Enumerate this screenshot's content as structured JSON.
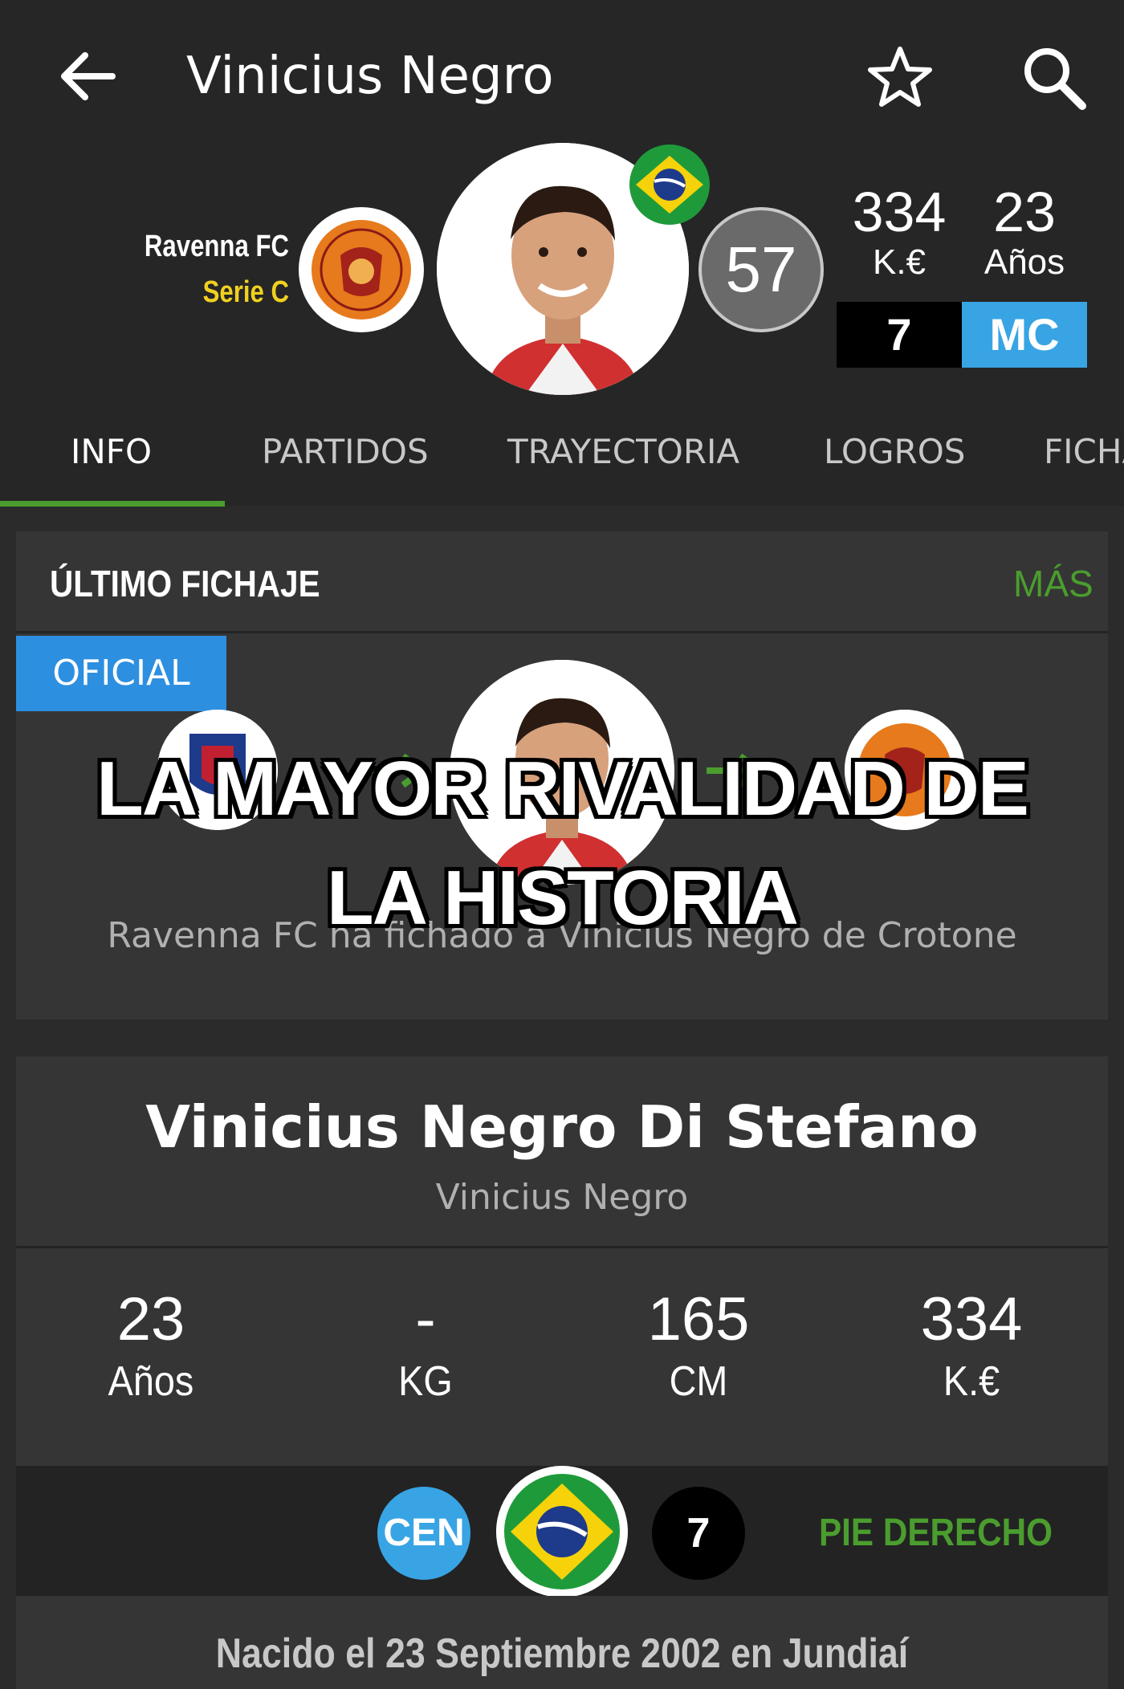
{
  "header": {
    "title": "Vinicius Negro",
    "back_icon": "arrow-left-icon",
    "favorite_icon": "star-outline-icon",
    "search_icon": "search-icon"
  },
  "player": {
    "club": "Ravenna FC",
    "league": "Serie C",
    "rating": "57",
    "value": "334",
    "value_unit": "K.€",
    "age": "23",
    "age_unit": "Años",
    "number": "7",
    "position": "MC"
  },
  "tabs": [
    {
      "label": "INFO",
      "active": true
    },
    {
      "label": "PARTIDOS"
    },
    {
      "label": "TRAYECTORIA"
    },
    {
      "label": "LOGROS"
    },
    {
      "label": "FICHA"
    }
  ],
  "transfer": {
    "title": "ÚLTIMO FICHAJE",
    "more": "MÁS",
    "badge": "OFICIAL",
    "description": "Ravenna FC ha fichado a Vinicius Negro de Crotone"
  },
  "overlay": {
    "line1": "LA MAYOR RIVALIDAD DE",
    "line2": "LA HISTORIA"
  },
  "profile": {
    "full_name": "Vinicius Negro Di Stefano",
    "short_name": "Vinicius Negro",
    "stats": [
      {
        "value": "23",
        "label": "Años"
      },
      {
        "value": "-",
        "label": "KG"
      },
      {
        "value": "165",
        "label": "CM"
      },
      {
        "value": "334",
        "label": "K.€"
      }
    ],
    "role": "CEN",
    "number": "7",
    "foot": "PIE DERECHO",
    "born": "Nacido el 23 Septiembre 2002 en Jundiaí"
  },
  "colors": {
    "accent_green": "#4a9d2e",
    "accent_blue": "#38a4e4",
    "league_yellow": "#f0d020"
  }
}
